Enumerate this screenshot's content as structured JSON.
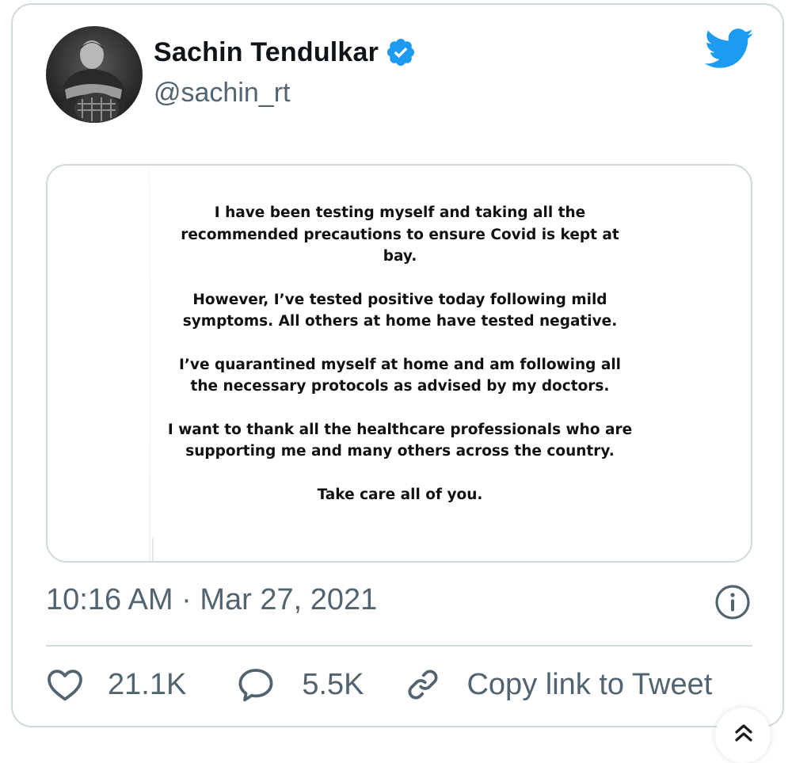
{
  "tweet": {
    "author": {
      "display_name": "Sachin Tendulkar",
      "handle": "@sachin_rt",
      "verified": true,
      "avatar_icon": "profile-photo"
    },
    "platform_icon": "twitter-bird-icon",
    "media": {
      "statement": [
        "I have been testing myself and taking all the recommended precautions to ensure Covid is kept at bay.",
        "However, I’ve tested positive today following mild symptoms. All others at home have tested negative.",
        "I’ve quarantined myself at home and am following all the necessary protocols as advised by my doctors.",
        "I want to thank all the healthcare professionals who are supporting me and many others across the country.",
        "Take care all of you."
      ]
    },
    "timestamp": "10:16 AM · Mar 27, 2021",
    "actions": {
      "likes": "21.1K",
      "replies": "5.5K",
      "copy_link_label": "Copy link to Tweet"
    }
  },
  "colors": {
    "twitter_blue": "#1d9bf0",
    "text_primary": "#0f1419",
    "text_secondary": "#536471",
    "border": "#cfd9de"
  }
}
